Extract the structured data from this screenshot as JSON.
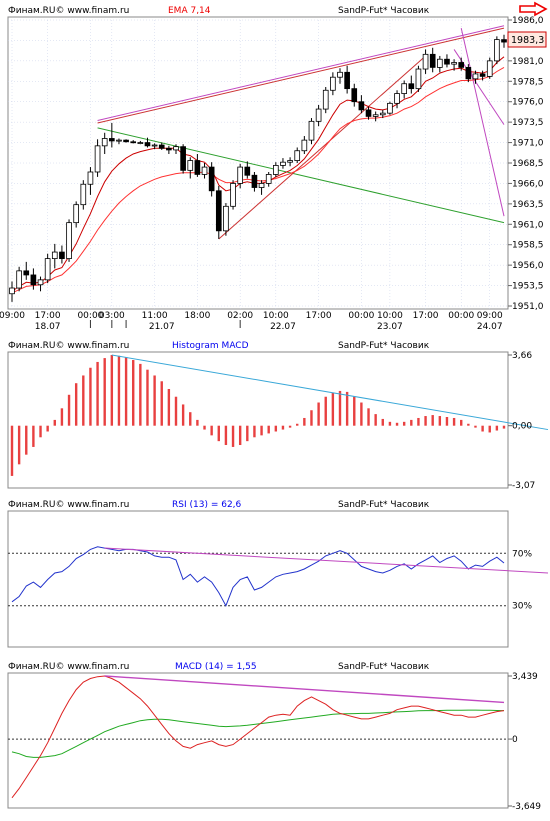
{
  "chart_data": [
    {
      "type": "candlestick",
      "header": {
        "source": "Финам.RU© www.finam.ru",
        "indicator": "EMA 7,14",
        "instrument": "SandP-Fut* Часовик"
      },
      "price_label": "1983,3",
      "ylim": [
        1951.0,
        1986.0
      ],
      "y_ticks": [
        "1986,0",
        "1983,5",
        "1981,0",
        "1978,5",
        "1976,0",
        "1973,5",
        "1971,0",
        "1968,5",
        "1966,0",
        "1963,5",
        "1961,0",
        "1958,5",
        "1956,0",
        "1953,5",
        "1951,0"
      ],
      "time_ticks": [
        "09:00",
        "17:00",
        "00:00",
        "03:00",
        "11:00",
        "18:00",
        "02:00",
        "10:00",
        "17:00",
        "00:00",
        "10:00",
        "17:00",
        "00:00",
        "09:00"
      ],
      "date_ticks": [
        "18.07",
        "21.07",
        "22.07",
        "23.07",
        "24.07"
      ],
      "candles": [
        [
          1952.5,
          1954.0,
          1951.5,
          1953.2
        ],
        [
          1953.2,
          1955.8,
          1952.8,
          1955.3
        ],
        [
          1955.3,
          1956.4,
          1954.2,
          1954.8
        ],
        [
          1954.8,
          1955.6,
          1953.0,
          1953.6
        ],
        [
          1953.6,
          1954.6,
          1952.8,
          1954.2
        ],
        [
          1954.2,
          1957.4,
          1953.8,
          1956.8
        ],
        [
          1956.8,
          1958.6,
          1955.6,
          1957.6
        ],
        [
          1957.6,
          1958.4,
          1956.2,
          1956.8
        ],
        [
          1956.8,
          1961.6,
          1956.4,
          1961.2
        ],
        [
          1961.2,
          1963.8,
          1960.6,
          1963.4
        ],
        [
          1963.4,
          1966.4,
          1962.8,
          1965.9
        ],
        [
          1965.9,
          1968.0,
          1964.6,
          1967.4
        ],
        [
          1967.4,
          1971.4,
          1966.8,
          1970.6
        ],
        [
          1970.6,
          1972.2,
          1969.6,
          1971.5
        ],
        [
          1971.5,
          1973.4,
          1970.4,
          1971.2
        ],
        [
          1971.2,
          1971.5,
          1970.8,
          1971.3
        ],
        [
          1971.3,
          1971.4,
          1971.0,
          1971.1
        ],
        [
          1971.1,
          1971.3,
          1970.9,
          1971.0
        ],
        [
          1971.0,
          1971.2,
          1970.8,
          1971.0
        ],
        [
          1971.0,
          1971.6,
          1970.4,
          1970.6
        ],
        [
          1970.6,
          1970.9,
          1970.2,
          1970.7
        ],
        [
          1970.7,
          1971.0,
          1970.1,
          1970.3
        ],
        [
          1970.3,
          1970.6,
          1969.6,
          1970.1
        ],
        [
          1970.1,
          1970.8,
          1969.6,
          1970.5
        ],
        [
          1970.5,
          1970.8,
          1967.2,
          1967.6
        ],
        [
          1967.6,
          1969.2,
          1966.6,
          1968.8
        ],
        [
          1968.8,
          1969.6,
          1966.8,
          1967.1
        ],
        [
          1967.1,
          1968.5,
          1966.6,
          1968.0
        ],
        [
          1968.0,
          1968.6,
          1964.4,
          1965.1
        ],
        [
          1965.1,
          1965.7,
          1959.2,
          1960.2
        ],
        [
          1960.2,
          1963.6,
          1959.6,
          1963.2
        ],
        [
          1963.2,
          1966.4,
          1962.8,
          1966.0
        ],
        [
          1966.0,
          1968.4,
          1965.4,
          1968.0
        ],
        [
          1968.0,
          1968.7,
          1966.6,
          1967.0
        ],
        [
          1967.0,
          1967.4,
          1965.0,
          1965.5
        ],
        [
          1965.5,
          1966.4,
          1964.6,
          1966.0
        ],
        [
          1966.0,
          1967.4,
          1965.6,
          1967.1
        ],
        [
          1967.1,
          1968.6,
          1966.8,
          1968.2
        ],
        [
          1968.2,
          1969.1,
          1967.8,
          1968.6
        ],
        [
          1968.6,
          1969.2,
          1968.1,
          1968.8
        ],
        [
          1968.8,
          1970.4,
          1968.5,
          1970.0
        ],
        [
          1970.0,
          1971.8,
          1969.6,
          1971.3
        ],
        [
          1971.3,
          1974.0,
          1970.8,
          1973.6
        ],
        [
          1973.6,
          1975.6,
          1973.0,
          1975.1
        ],
        [
          1975.1,
          1977.8,
          1974.6,
          1977.4
        ],
        [
          1977.4,
          1979.6,
          1976.8,
          1979.0
        ],
        [
          1979.0,
          1980.1,
          1978.2,
          1979.6
        ],
        [
          1979.6,
          1980.4,
          1977.0,
          1977.6
        ],
        [
          1977.6,
          1978.2,
          1975.4,
          1976.0
        ],
        [
          1976.0,
          1976.8,
          1974.6,
          1975.0
        ],
        [
          1975.0,
          1975.4,
          1973.8,
          1974.2
        ],
        [
          1974.2,
          1974.8,
          1973.6,
          1974.4
        ],
        [
          1974.4,
          1975.0,
          1974.0,
          1974.6
        ],
        [
          1974.6,
          1976.0,
          1974.4,
          1975.8
        ],
        [
          1975.8,
          1977.4,
          1975.2,
          1977.0
        ],
        [
          1977.0,
          1978.6,
          1976.4,
          1978.2
        ],
        [
          1978.2,
          1979.2,
          1977.0,
          1977.6
        ],
        [
          1977.6,
          1980.4,
          1977.2,
          1980.0
        ],
        [
          1980.0,
          1982.4,
          1979.4,
          1981.8
        ],
        [
          1981.8,
          1982.6,
          1979.6,
          1980.2
        ],
        [
          1980.2,
          1981.6,
          1979.6,
          1981.2
        ],
        [
          1981.2,
          1981.8,
          1980.2,
          1980.6
        ],
        [
          1980.6,
          1981.2,
          1979.8,
          1980.8
        ],
        [
          1980.8,
          1981.4,
          1979.8,
          1980.2
        ],
        [
          1980.2,
          1980.6,
          1978.4,
          1978.8
        ],
        [
          1978.8,
          1979.8,
          1978.2,
          1979.4
        ],
        [
          1979.4,
          1979.8,
          1978.6,
          1979.1
        ],
        [
          1979.1,
          1981.4,
          1978.8,
          1981.0
        ],
        [
          1981.0,
          1984.0,
          1980.6,
          1983.6
        ],
        [
          1983.6,
          1984.2,
          1982.6,
          1983.3
        ]
      ],
      "ema_fast": [
        1952.8,
        1953.4,
        1953.9,
        1953.8,
        1953.9,
        1954.6,
        1955.4,
        1955.7,
        1957.1,
        1958.6,
        1960.5,
        1962.3,
        1964.4,
        1966.2,
        1967.5,
        1968.4,
        1969.1,
        1969.6,
        1969.9,
        1970.1,
        1970.3,
        1970.3,
        1970.3,
        1970.3,
        1969.6,
        1969.4,
        1968.8,
        1968.6,
        1967.7,
        1965.8,
        1965.1,
        1965.3,
        1966.0,
        1966.2,
        1966.0,
        1966.0,
        1966.3,
        1966.8,
        1967.2,
        1967.6,
        1968.2,
        1969.0,
        1970.2,
        1971.4,
        1972.9,
        1974.4,
        1975.7,
        1976.2,
        1976.1,
        1975.8,
        1975.4,
        1975.1,
        1975.0,
        1975.2,
        1975.7,
        1976.3,
        1976.6,
        1977.4,
        1978.5,
        1978.9,
        1979.5,
        1979.8,
        1980.0,
        1980.1,
        1979.7,
        1979.6,
        1979.5,
        1979.8,
        1980.8,
        1981.5
      ],
      "ema_slow": [
        1952.6,
        1953.0,
        1953.4,
        1953.5,
        1953.6,
        1954.0,
        1954.5,
        1954.8,
        1955.6,
        1956.5,
        1957.7,
        1958.9,
        1960.3,
        1961.5,
        1962.6,
        1963.6,
        1964.4,
        1965.1,
        1965.7,
        1966.1,
        1966.5,
        1966.8,
        1967.0,
        1967.2,
        1967.3,
        1967.3,
        1967.3,
        1967.4,
        1967.1,
        1966.5,
        1966.1,
        1966.1,
        1966.4,
        1966.5,
        1966.4,
        1966.3,
        1966.4,
        1966.6,
        1966.9,
        1967.2,
        1967.6,
        1968.1,
        1968.8,
        1969.6,
        1970.6,
        1971.7,
        1972.7,
        1973.3,
        1973.7,
        1973.9,
        1974.0,
        1974.0,
        1974.1,
        1974.3,
        1974.6,
        1975.1,
        1975.4,
        1975.9,
        1976.6,
        1977.1,
        1977.6,
        1978.0,
        1978.3,
        1978.6,
        1978.6,
        1978.7,
        1978.8,
        1979.1,
        1979.7,
        1980.2
      ]
    },
    {
      "type": "bar",
      "header": {
        "source": "Финам.RU© www.finam.ru",
        "indicator": "Histogram MACD",
        "instrument": "SandP-Fut* Часовик"
      },
      "ylim": [
        -3.07,
        3.66
      ],
      "y_ticks": [
        "3,66",
        "0,00",
        "-3,07"
      ],
      "values": [
        -2.6,
        -2.0,
        -1.5,
        -1.1,
        -0.6,
        -0.3,
        0.3,
        0.9,
        1.6,
        2.2,
        2.6,
        3.0,
        3.3,
        3.5,
        3.66,
        3.62,
        3.55,
        3.4,
        3.2,
        2.9,
        2.6,
        2.3,
        1.9,
        1.5,
        1.1,
        0.7,
        0.3,
        -0.2,
        -0.5,
        -0.8,
        -1.0,
        -1.1,
        -1.0,
        -0.8,
        -0.6,
        -0.5,
        -0.4,
        -0.3,
        -0.2,
        -0.1,
        0.1,
        0.4,
        0.8,
        1.2,
        1.5,
        1.7,
        1.8,
        1.75,
        1.5,
        1.2,
        0.9,
        0.6,
        0.35,
        0.2,
        0.15,
        0.2,
        0.3,
        0.4,
        0.5,
        0.55,
        0.5,
        0.45,
        0.4,
        0.3,
        0.1,
        -0.1,
        -0.3,
        -0.35,
        -0.25,
        -0.15
      ],
      "trendline": [
        [
          14,
          3.66
        ],
        [
          69,
          -0.1
        ]
      ]
    },
    {
      "type": "line",
      "header": {
        "source": "Финам.RU© www.finam.ru",
        "indicator": "RSI (13) = 62,6",
        "instrument": "SandP-Fut* Часовик"
      },
      "ylim": [
        0,
        100
      ],
      "levels": [
        {
          "label": "70%",
          "value": 70
        },
        {
          "label": "30%",
          "value": 30
        }
      ],
      "values": [
        33,
        37,
        45,
        48,
        44,
        50,
        55,
        56,
        60,
        66,
        69,
        73,
        75,
        74,
        73,
        72,
        73,
        73,
        72,
        71,
        68,
        67,
        67,
        65,
        50,
        54,
        48,
        52,
        48,
        40,
        30,
        44,
        50,
        52,
        42,
        44,
        48,
        52,
        54,
        55,
        56,
        58,
        61,
        64,
        68,
        70,
        72,
        70,
        65,
        60,
        58,
        56,
        55,
        57,
        60,
        62,
        58,
        62,
        65,
        68,
        63,
        66,
        68,
        64,
        58,
        61,
        60,
        64,
        67,
        62.6
      ],
      "trendline": [
        [
          13,
          74
        ],
        [
          69,
          58
        ]
      ]
    },
    {
      "type": "line",
      "header": {
        "source": "Финам.RU© www.finam.ru",
        "indicator": "MACD (14) = 1,55",
        "instrument": "SandP-Fut* Часовик"
      },
      "ylim": [
        -3.649,
        3.439
      ],
      "y_ticks": [
        "3,439",
        "0",
        "-3,649"
      ],
      "series": [
        {
          "values": [
            -3.2,
            -2.7,
            -2.1,
            -1.5,
            -0.9,
            -0.2,
            0.6,
            1.4,
            2.1,
            2.7,
            3.1,
            3.3,
            3.4,
            3.44,
            3.3,
            3.1,
            2.8,
            2.5,
            2.2,
            1.8,
            1.3,
            0.8,
            0.3,
            -0.1,
            -0.4,
            -0.5,
            -0.3,
            -0.2,
            -0.1,
            -0.3,
            -0.4,
            -0.3,
            0.0,
            0.3,
            0.6,
            0.9,
            1.2,
            1.3,
            1.35,
            1.3,
            1.8,
            2.1,
            2.3,
            2.1,
            1.9,
            1.6,
            1.4,
            1.3,
            1.2,
            1.1,
            1.1,
            1.2,
            1.3,
            1.4,
            1.6,
            1.7,
            1.8,
            1.8,
            1.7,
            1.6,
            1.5,
            1.4,
            1.3,
            1.3,
            1.2,
            1.2,
            1.3,
            1.4,
            1.5,
            1.55
          ]
        },
        {
          "values": [
            -0.7,
            -0.8,
            -0.95,
            -1.0,
            -1.0,
            -0.95,
            -0.9,
            -0.8,
            -0.6,
            -0.4,
            -0.2,
            0.0,
            0.2,
            0.4,
            0.55,
            0.7,
            0.8,
            0.9,
            1.0,
            1.05,
            1.08,
            1.08,
            1.05,
            1.0,
            0.95,
            0.9,
            0.85,
            0.8,
            0.75,
            0.7,
            0.68,
            0.7,
            0.72,
            0.75,
            0.8,
            0.85,
            0.9,
            0.95,
            1.0,
            1.05,
            1.1,
            1.15,
            1.2,
            1.25,
            1.3,
            1.35,
            1.37,
            1.38,
            1.39,
            1.4,
            1.4,
            1.42,
            1.44,
            1.46,
            1.48,
            1.5,
            1.52,
            1.54,
            1.55,
            1.55,
            1.56,
            1.57,
            1.57,
            1.57,
            1.58,
            1.58,
            1.57,
            1.57,
            1.56,
            1.55
          ]
        }
      ],
      "trendline": [
        [
          13,
          3.44
        ],
        [
          69,
          2.0
        ]
      ]
    }
  ],
  "colors": {
    "candle_up": "#ffffff",
    "candle_down": "#000000",
    "ema_fast": "#cc0000",
    "ema_slow": "#ff3333",
    "trend_red": "#cc3333",
    "trend_green": "#2ea02e",
    "trend_purple": "#c048c0",
    "hist": "#e84040",
    "hist_trend": "#3aa8d8",
    "rsi": "#2233cc",
    "macd_main": "#dd2222",
    "macd_signal": "#22aa22",
    "grid": "#c8d0e8",
    "header_blue": "#0000ee",
    "header_red": "#ee0000",
    "price_box": "#ffe8e0",
    "price_border": "#cc0000"
  }
}
